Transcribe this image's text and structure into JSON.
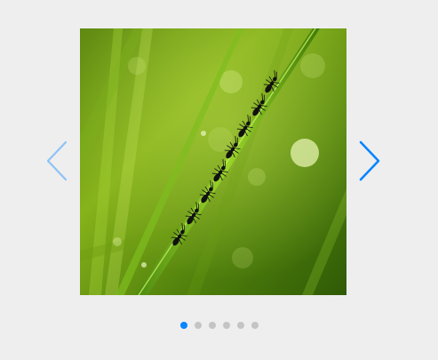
{
  "carousel": {
    "image": {
      "subject": "ants-on-grass-blade-icon"
    },
    "prev_button": {
      "icon": "chevron-left-icon",
      "color": "#8ec3f5"
    },
    "next_button": {
      "icon": "chevron-right-icon",
      "color": "#0a84ff"
    },
    "pagination": {
      "count": 6,
      "active_index": 0,
      "active_color": "#0a84ff",
      "inactive_color": "#c4c4c4"
    }
  }
}
